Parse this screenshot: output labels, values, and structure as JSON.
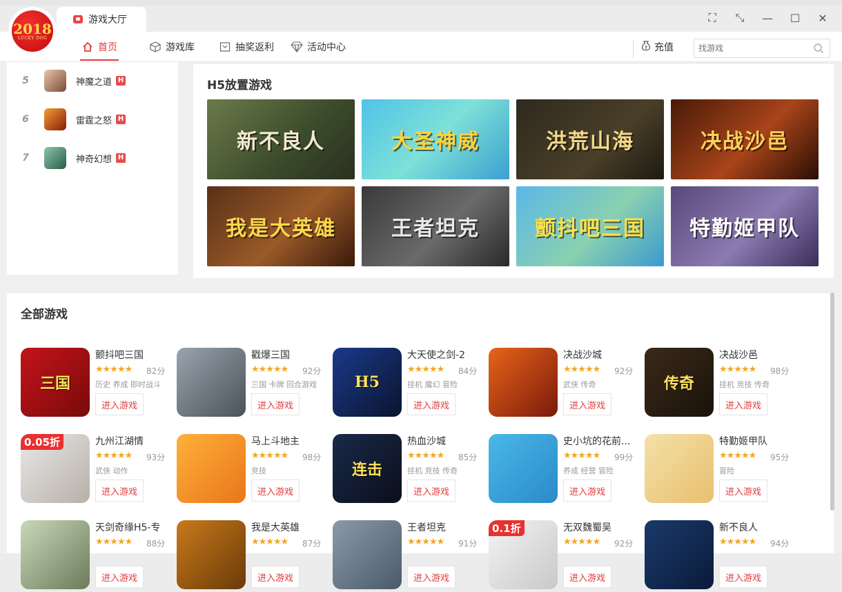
{
  "app": {
    "logo_year": "2018",
    "logo_text": "LUCKY DOG",
    "tab_title": "游戏大厅"
  },
  "window_controls": [
    "⛶",
    "⤡",
    "—",
    "☐",
    "✕"
  ],
  "nav": {
    "items": [
      {
        "label": "首页",
        "icon": "home-icon",
        "active": true
      },
      {
        "label": "游戏库",
        "icon": "cube-icon",
        "active": false
      },
      {
        "label": "抽奖返利",
        "icon": "lottery-icon",
        "active": false
      },
      {
        "label": "活动中心",
        "icon": "diamond-icon",
        "active": false
      }
    ],
    "recharge": "充值",
    "search_placeholder": "找游戏"
  },
  "ranking": [
    {
      "rank": "5",
      "name": "神魔之道",
      "badge": "H",
      "color": "#b98a6a"
    },
    {
      "rank": "6",
      "name": "雷霆之怒",
      "badge": "H",
      "color": "#c23a1a"
    },
    {
      "rank": "7",
      "name": "神奇幻想",
      "badge": "H",
      "color": "#4f8a6a"
    }
  ],
  "h5": {
    "title": "H5放置游戏",
    "banners": [
      {
        "text": "新不良人",
        "bg": "linear-gradient(135deg,#6b7a4a,#3a4a2a 60%,#2a3020)",
        "fg": "#f2ead0"
      },
      {
        "text": "大圣神威",
        "bg": "linear-gradient(135deg,#4fc3e8,#7ee0d8 50%,#3aa0d0)",
        "fg": "#ffd33a"
      },
      {
        "text": "洪荒山海",
        "bg": "linear-gradient(135deg,#2e2a1e,#4a3f28 60%,#1e1a12)",
        "fg": "#f4d98a"
      },
      {
        "text": "决战沙邑",
        "bg": "linear-gradient(135deg,#4a1a08,#a8441a 55%,#2a0e04)",
        "fg": "#ffcf5a"
      },
      {
        "text": "我是大英雄",
        "bg": "linear-gradient(135deg,#5a3018,#9a5a28 55%,#3a1a0a)",
        "fg": "#ffd84a"
      },
      {
        "text": "王者坦克",
        "bg": "linear-gradient(135deg,#3a3a3a,#6a6a6a 55%,#2a2a2a)",
        "fg": "#e8e8e8"
      },
      {
        "text": "颤抖吧三国",
        "bg": "linear-gradient(135deg,#5ab8e8,#8ad0b0 55%,#3a9ad0)",
        "fg": "#ffe04a"
      },
      {
        "text": "特勤姬甲队",
        "bg": "linear-gradient(135deg,#5a4a7a,#8a7ab0 55%,#3a2e5a)",
        "fg": "#ffffff"
      }
    ]
  },
  "all_games": {
    "title": "全部游戏",
    "play_label": "进入游戏",
    "items": [
      {
        "name": "颤抖吧三国",
        "stars": "★★★★★",
        "score": "82分",
        "tags": "历史 养成 即时战斗",
        "bg": "linear-gradient(135deg,#c2141a,#7a0a0a)",
        "glyph": "三国",
        "discount": ""
      },
      {
        "name": "戳爆三国",
        "stars": "★★★★★",
        "score": "92分",
        "tags": "三国 卡牌 回合游戏",
        "bg": "linear-gradient(135deg,#9aa4ae,#4a525a)",
        "glyph": "",
        "discount": ""
      },
      {
        "name": "大天使之剑-2",
        "stars": "★★★★★",
        "score": "84分",
        "tags": "挂机 魔幻 冒险",
        "bg": "linear-gradient(135deg,#1a3a8a,#0a1430)",
        "glyph": "H5",
        "discount": ""
      },
      {
        "name": "决战沙城",
        "stars": "★★★★★",
        "score": "92分",
        "tags": "武侠 传奇",
        "bg": "linear-gradient(135deg,#e8641a,#7a1a0a)",
        "glyph": "",
        "discount": ""
      },
      {
        "name": "决战沙邑",
        "stars": "★★★★★",
        "score": "98分",
        "tags": "挂机 竞技 传奇",
        "bg": "linear-gradient(135deg,#3a2a1a,#1a120a)",
        "glyph": "传奇",
        "discount": ""
      },
      {
        "name": "九州江湖情",
        "stars": "★★★★★",
        "score": "93分",
        "tags": "武侠 动作",
        "bg": "linear-gradient(135deg,#e8e8e8,#b8b0a8)",
        "glyph": "",
        "discount": "0.05折"
      },
      {
        "name": "马上斗地主",
        "stars": "★★★★★",
        "score": "98分",
        "tags": "竞技",
        "bg": "linear-gradient(135deg,#ffb03a,#e8761a)",
        "glyph": "",
        "discount": ""
      },
      {
        "name": "热血沙城",
        "stars": "★★★★★",
        "score": "85分",
        "tags": "挂机 竞技 传奇",
        "bg": "linear-gradient(135deg,#1a2a4a,#0a0e1a)",
        "glyph": "连击",
        "discount": ""
      },
      {
        "name": "史小坑的花前...",
        "stars": "★★★★★",
        "score": "99分",
        "tags": "养成 经营 冒险",
        "bg": "linear-gradient(135deg,#4ab8e8,#2a8ac8)",
        "glyph": "",
        "discount": ""
      },
      {
        "name": "特勤姬甲队",
        "stars": "★★★★★",
        "score": "95分",
        "tags": "冒险",
        "bg": "linear-gradient(135deg,#f4e0a8,#e8c070)",
        "glyph": "",
        "discount": ""
      },
      {
        "name": "天剑奇缘H5-专",
        "stars": "★★★★★",
        "score": "88分",
        "tags": "",
        "bg": "linear-gradient(135deg,#c8d8b8,#6a7a5a)",
        "glyph": "",
        "discount": ""
      },
      {
        "name": "我是大英雄",
        "stars": "★★★★★",
        "score": "87分",
        "tags": "",
        "bg": "linear-gradient(135deg,#c87a1a,#6a3a0a)",
        "glyph": "",
        "discount": ""
      },
      {
        "name": "王者坦克",
        "stars": "★★★★★",
        "score": "91分",
        "tags": "",
        "bg": "linear-gradient(135deg,#8a9aa8,#4a5a68)",
        "glyph": "",
        "discount": ""
      },
      {
        "name": "无双魏蜀吴",
        "stars": "★★★★★",
        "score": "92分",
        "tags": "",
        "bg": "linear-gradient(135deg,#f4f4f4,#c8c8c8)",
        "glyph": "",
        "discount": "0.1折"
      },
      {
        "name": "新不良人",
        "stars": "★★★★★",
        "score": "94分",
        "tags": "",
        "bg": "linear-gradient(135deg,#1a3a6a,#0a1a3a)",
        "glyph": "",
        "discount": ""
      }
    ]
  }
}
